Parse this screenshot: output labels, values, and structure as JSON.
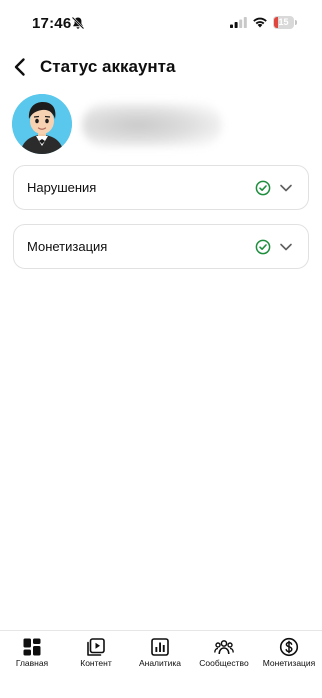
{
  "status_bar": {
    "time": "17:46",
    "battery_level": "15",
    "icons": [
      "bell-muted-icon",
      "signal-icon",
      "wifi-icon",
      "battery-icon"
    ]
  },
  "header": {
    "title": "Статус аккаунта",
    "back_icon": "chevron-left-icon"
  },
  "profile": {
    "avatar_icon": "avatar-cartoon"
  },
  "sections": [
    {
      "label": "Нарушения",
      "status_icon": "check-circle-icon",
      "status_color": "#1e8e3e"
    },
    {
      "label": "Монетизация",
      "status_icon": "check-circle-icon",
      "status_color": "#1e8e3e"
    }
  ],
  "bottom_nav": {
    "items": [
      {
        "label": "Главная",
        "icon": "dashboard-icon"
      },
      {
        "label": "Контент",
        "icon": "video-content-icon"
      },
      {
        "label": "Аналитика",
        "icon": "analytics-icon"
      },
      {
        "label": "Сообщество",
        "icon": "community-icon"
      },
      {
        "label": "Монетизация",
        "icon": "dollar-circle-icon"
      }
    ]
  },
  "colors": {
    "accent_green": "#1e8e3e",
    "battery_low": "#e0463d",
    "text": "#0f0f0f",
    "border": "#e1e1e1"
  }
}
